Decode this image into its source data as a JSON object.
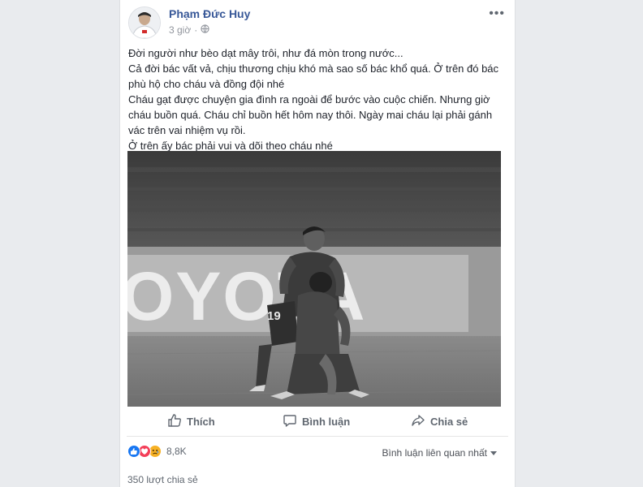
{
  "post": {
    "author": "Phạm Đức Huy",
    "time": "3 giờ",
    "lines": [
      "Đời người như bèo dạt mây trôi, như đá mòn trong nước...",
      "Cả đời bác vất vả, chịu thương chịu khó mà sao số bác khổ quá. Ở trên đó bác",
      "phù hộ cho cháu và đồng đội nhé",
      "Cháu gạt được chuyện gia đình ra ngoài để bước vào cuộc chiến. Nhưng giờ",
      "cháu buồn quá. Cháu chỉ buồn hết hôm nay thôi. Ngày mai cháu lại phải gánh",
      "vác trên vai nhiệm vụ rồi.",
      "Ở trên ấy bác phải vui và dõi theo cháu nhé"
    ],
    "photo": {
      "banner_text": "OYOTA",
      "jersey_number": "19"
    }
  },
  "actions": {
    "like": "Thích",
    "comment": "Bình luận",
    "share": "Chia sẻ"
  },
  "stats": {
    "reaction_count": "8,8K",
    "sort_label": "Bình luận liên quan nhất",
    "shares": "350 lượt chia sẻ"
  },
  "icons": {
    "globe": "globe-icon",
    "more": "more-options-icon",
    "like": "thumbs-up-icon",
    "comment": "comment-bubble-icon",
    "share": "share-arrow-icon",
    "reactions": [
      "like-reaction-icon",
      "love-reaction-icon",
      "sad-reaction-icon"
    ]
  },
  "colors": {
    "link": "#385898",
    "like_blue": "#1877f2",
    "love_red": "#f33e58",
    "sad_yellow": "#f7b125"
  }
}
